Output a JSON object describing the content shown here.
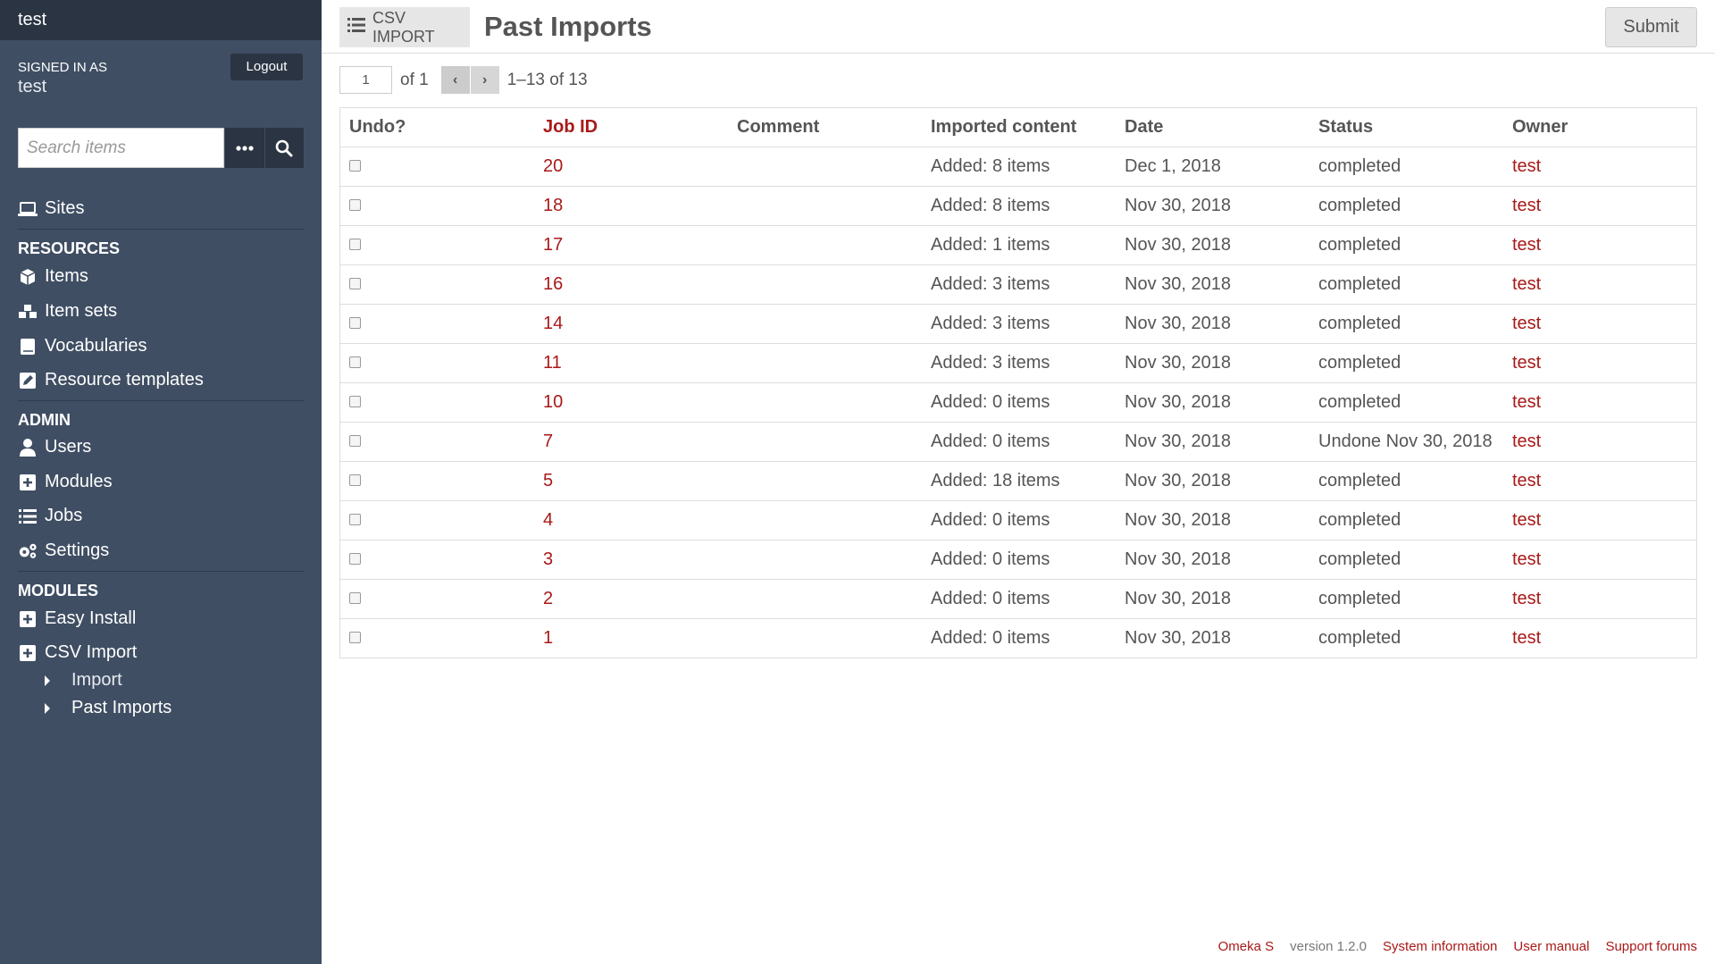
{
  "site": {
    "title": "test"
  },
  "user": {
    "signed_in_label": "SIGNED IN AS",
    "name": "test",
    "logout_label": "Logout"
  },
  "search": {
    "placeholder": "Search items",
    "options_icon": "ellipsis-icon",
    "submit_icon": "search-icon"
  },
  "nav": {
    "sites_label": "Sites",
    "resources_heading": "RESOURCES",
    "resources": [
      {
        "label": "Items",
        "icon": "cube-icon"
      },
      {
        "label": "Item sets",
        "icon": "cubes-icon"
      },
      {
        "label": "Vocabularies",
        "icon": "book-icon"
      },
      {
        "label": "Resource templates",
        "icon": "edit-icon"
      }
    ],
    "admin_heading": "ADMIN",
    "admin": [
      {
        "label": "Users",
        "icon": "user-icon"
      },
      {
        "label": "Modules",
        "icon": "plus-square-icon"
      },
      {
        "label": "Jobs",
        "icon": "list-icon"
      },
      {
        "label": "Settings",
        "icon": "cogs-icon"
      }
    ],
    "modules_heading": "MODULES",
    "modules": [
      {
        "label": "Easy Install",
        "icon": "plus-square-icon"
      },
      {
        "label": "CSV Import",
        "icon": "plus-square-icon"
      }
    ],
    "csv_sub": [
      {
        "label": "Import"
      },
      {
        "label": "Past Imports"
      }
    ]
  },
  "header": {
    "module_label": "CSV IMPORT",
    "page_title": "Past Imports",
    "submit_label": "Submit"
  },
  "pagination": {
    "current_page": "1",
    "of_label": "of 1",
    "range": "1–13 of 13"
  },
  "table": {
    "columns": [
      "Undo?",
      "Job ID",
      "Comment",
      "Imported content",
      "Date",
      "Status",
      "Owner"
    ],
    "rows": [
      {
        "job_id": "20",
        "comment": "",
        "content": "Added: 8 items",
        "date": "Dec 1, 2018",
        "status": "completed",
        "owner": "test"
      },
      {
        "job_id": "18",
        "comment": "",
        "content": "Added: 8 items",
        "date": "Nov 30, 2018",
        "status": "completed",
        "owner": "test"
      },
      {
        "job_id": "17",
        "comment": "",
        "content": "Added: 1 items",
        "date": "Nov 30, 2018",
        "status": "completed",
        "owner": "test"
      },
      {
        "job_id": "16",
        "comment": "",
        "content": "Added: 3 items",
        "date": "Nov 30, 2018",
        "status": "completed",
        "owner": "test"
      },
      {
        "job_id": "14",
        "comment": "",
        "content": "Added: 3 items",
        "date": "Nov 30, 2018",
        "status": "completed",
        "owner": "test"
      },
      {
        "job_id": "11",
        "comment": "",
        "content": "Added: 3 items",
        "date": "Nov 30, 2018",
        "status": "completed",
        "owner": "test"
      },
      {
        "job_id": "10",
        "comment": "",
        "content": "Added: 0 items",
        "date": "Nov 30, 2018",
        "status": "completed",
        "owner": "test"
      },
      {
        "job_id": "7",
        "comment": "",
        "content": "Added: 0 items",
        "date": "Nov 30, 2018",
        "status": "Undone Nov 30, 2018",
        "owner": "test"
      },
      {
        "job_id": "5",
        "comment": "",
        "content": "Added: 18 items",
        "date": "Nov 30, 2018",
        "status": "completed",
        "owner": "test"
      },
      {
        "job_id": "4",
        "comment": "",
        "content": "Added: 0 items",
        "date": "Nov 30, 2018",
        "status": "completed",
        "owner": "test"
      },
      {
        "job_id": "3",
        "comment": "",
        "content": "Added: 0 items",
        "date": "Nov 30, 2018",
        "status": "completed",
        "owner": "test"
      },
      {
        "job_id": "2",
        "comment": "",
        "content": "Added: 0 items",
        "date": "Nov 30, 2018",
        "status": "completed",
        "owner": "test"
      },
      {
        "job_id": "1",
        "comment": "",
        "content": "Added: 0 items",
        "date": "Nov 30, 2018",
        "status": "completed",
        "owner": "test"
      }
    ]
  },
  "footer": {
    "omeka": "Omeka S",
    "version": "version 1.2.0",
    "system_info": "System information",
    "user_manual": "User manual",
    "support": "Support forums"
  },
  "colors": {
    "sidebar": "#3f4e63",
    "sidebar_dark": "#2b3442",
    "link": "#a91919"
  }
}
